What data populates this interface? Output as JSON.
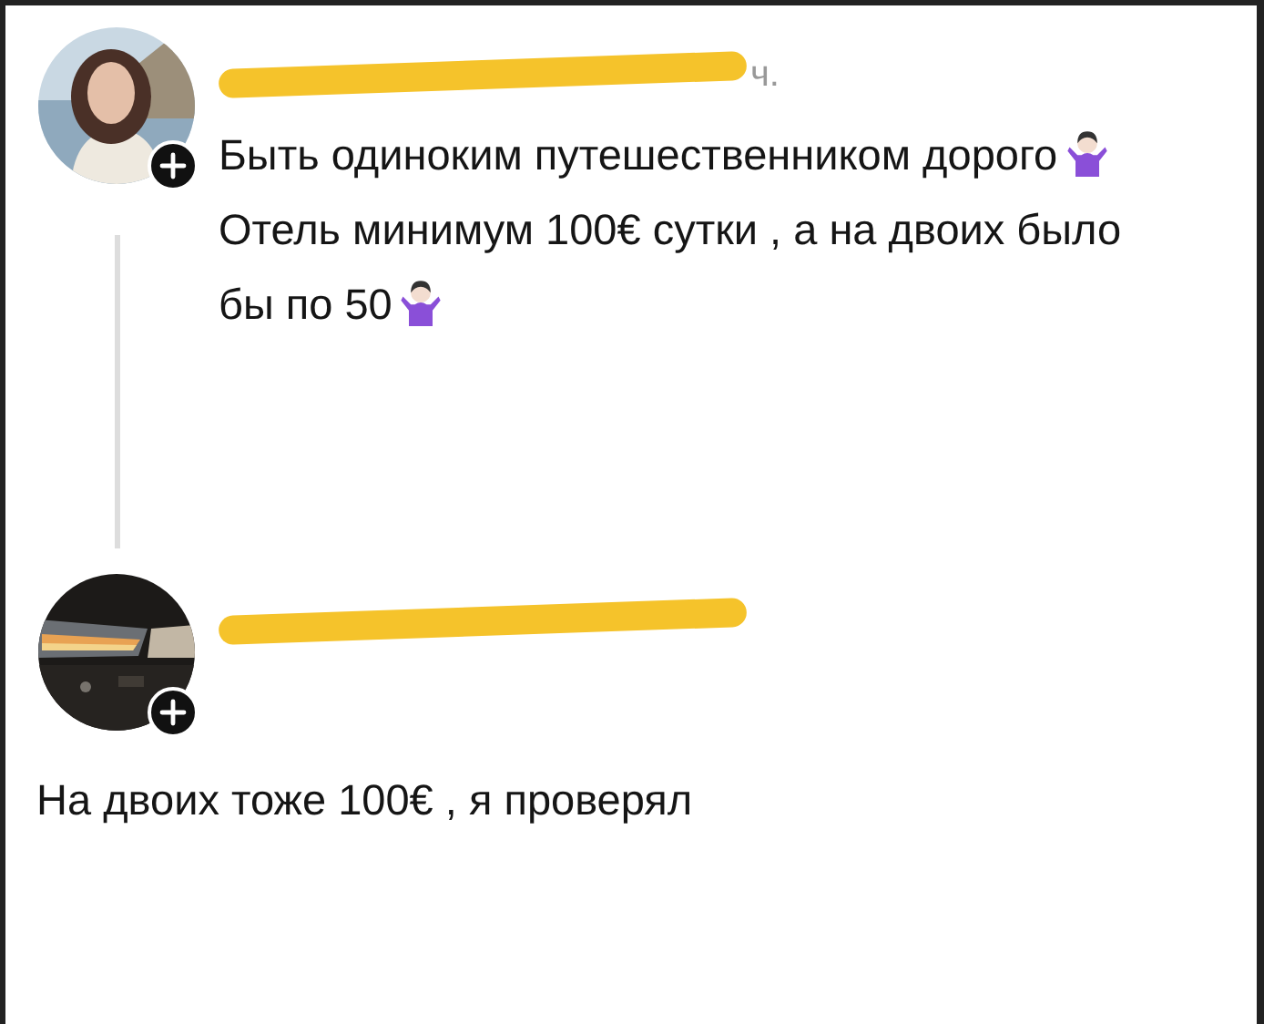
{
  "posts": [
    {
      "avatar": {
        "kind": "portrait"
      },
      "time": "ч.",
      "paragraphs": [
        {
          "text": "Быть одиноким путешественником дорого",
          "shrug_icon": true
        },
        {
          "text": "Отель минимум 100€ сутки , а на двоих было бы по 50",
          "shrug_icon": true
        }
      ],
      "thread_line": true,
      "body_indented": true
    },
    {
      "avatar": {
        "kind": "picture"
      },
      "paragraphs": [
        {
          "text": "На двоих тоже 100€ , я проверял",
          "shrug_icon": false
        }
      ],
      "thread_line": false,
      "body_indented": false
    }
  ]
}
